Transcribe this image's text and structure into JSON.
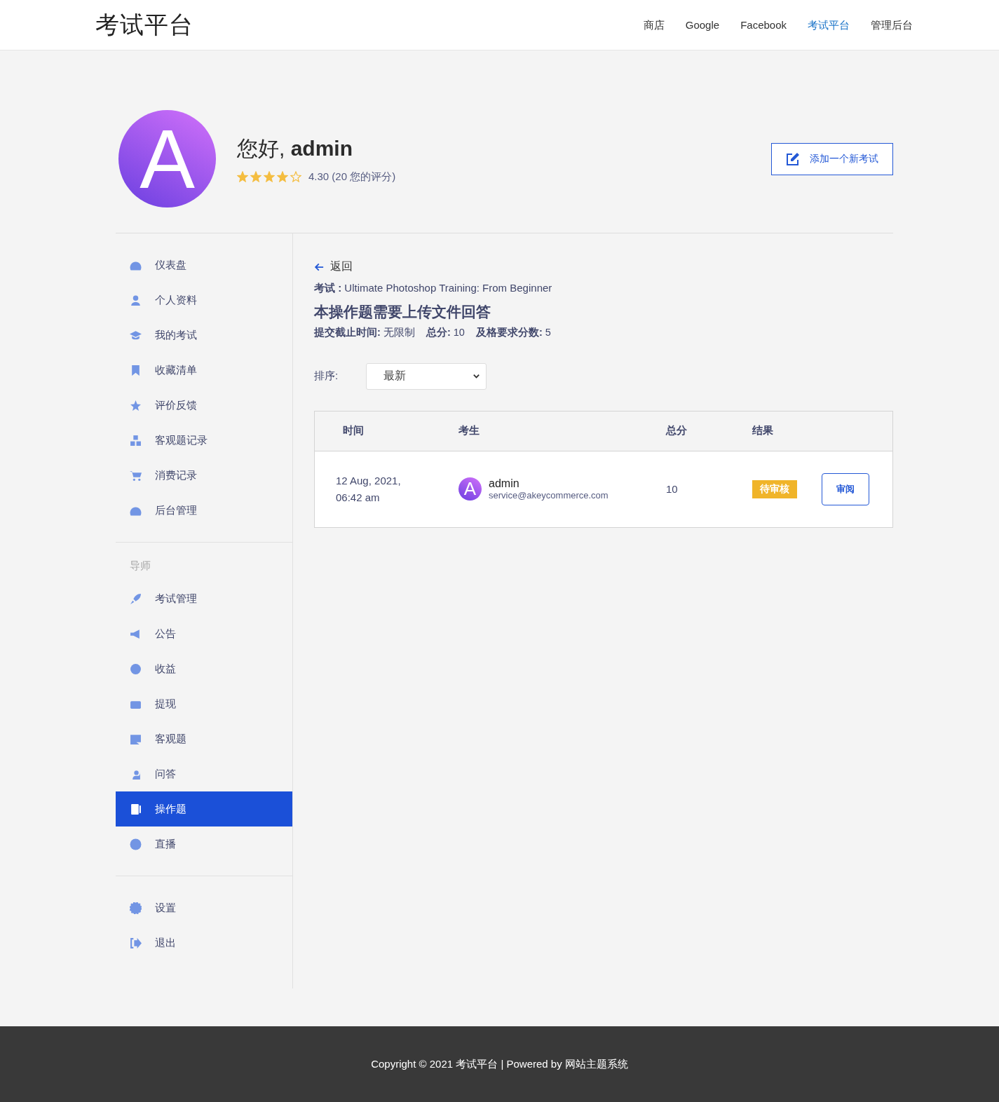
{
  "header": {
    "logo": "考试平台",
    "nav": [
      {
        "label": "商店",
        "selected": false
      },
      {
        "label": "Google",
        "selected": false
      },
      {
        "label": "Facebook",
        "selected": false
      },
      {
        "label": "考试平台",
        "selected": true
      },
      {
        "label": "管理后台",
        "selected": false
      }
    ]
  },
  "profile": {
    "avatar_letter": "A",
    "greeting": "您好,",
    "name": "admin",
    "stars": 4,
    "rating": "4.30 (20 您的评分)",
    "add_button": "添加一个新考试"
  },
  "sidebar": {
    "groups": [
      {
        "items": [
          {
            "label": "仪表盘",
            "selected": false
          },
          {
            "label": "个人资料",
            "selected": false
          },
          {
            "label": "我的考试",
            "selected": false
          },
          {
            "label": "收藏清单",
            "selected": false
          },
          {
            "label": "评价反馈",
            "selected": false
          },
          {
            "label": "客观题记录",
            "selected": false
          },
          {
            "label": "消费记录",
            "selected": false
          },
          {
            "label": "后台管理",
            "selected": false
          }
        ]
      },
      {
        "heading": "导师",
        "items": [
          {
            "label": "考试管理",
            "selected": false
          },
          {
            "label": "公告",
            "selected": false
          },
          {
            "label": "收益",
            "selected": false
          },
          {
            "label": "提现",
            "selected": false
          },
          {
            "label": "客观题",
            "selected": false
          },
          {
            "label": "问答",
            "selected": false
          },
          {
            "label": "操作题",
            "selected": true
          },
          {
            "label": "直播",
            "selected": false
          }
        ]
      },
      {
        "items": [
          {
            "label": "设置",
            "selected": false
          },
          {
            "label": "退出",
            "selected": false
          }
        ]
      }
    ]
  },
  "main": {
    "back": "返回",
    "exam_label": "考试 :",
    "exam_name": "Ultimate Photoshop Training: From Beginner",
    "title": "本操作题需要上传文件回答",
    "meta": [
      {
        "label": "提交截止时间:",
        "value": "无限制"
      },
      {
        "label": "总分:",
        "value": "10"
      },
      {
        "label": "及格要求分数:",
        "value": "5"
      }
    ],
    "sort": {
      "label": "排序:",
      "value": "最新"
    },
    "table": {
      "columns": [
        "时间",
        "考生",
        "总分",
        "结果"
      ],
      "rows": [
        {
          "time": "12 Aug, 2021, 06:42 am",
          "avatar_letter": "A",
          "name": "admin",
          "email": "service@akeycommerce.com",
          "score": "10",
          "status": "待审核",
          "color": "#f0b429",
          "action": "审阅"
        }
      ]
    }
  },
  "footer": {
    "text": "Copyright © 2021 考试平台 | Powered by 网站主题系统"
  }
}
